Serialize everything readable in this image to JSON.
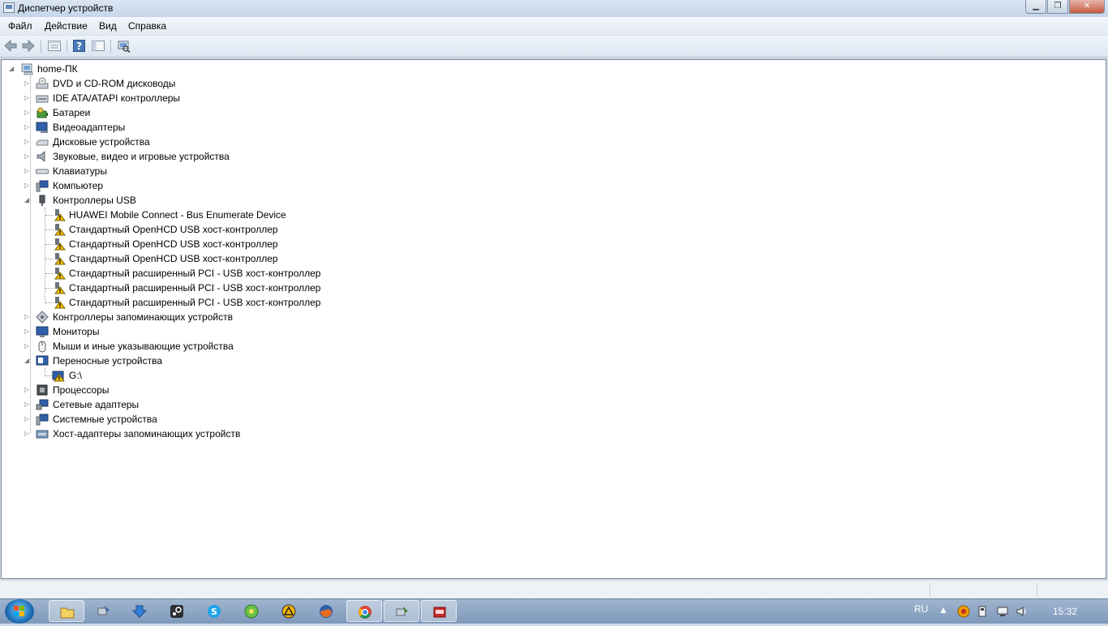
{
  "window": {
    "title": "Диспетчер устройств"
  },
  "menu": {
    "items": [
      "Файл",
      "Действие",
      "Вид",
      "Справка"
    ]
  },
  "toolbar": {
    "buttons": [
      "back-icon",
      "forward-icon",
      "properties-icon",
      "help-icon",
      "show-hide-icon",
      "scan-hardware-icon"
    ]
  },
  "tree": {
    "root": "home-ПК",
    "items": [
      {
        "label": "DVD и CD-ROM дисководы"
      },
      {
        "label": "IDE ATA/ATAPI контроллеры"
      },
      {
        "label": "Батареи"
      },
      {
        "label": "Видеоадаптеры"
      },
      {
        "label": "Дисковые устройства"
      },
      {
        "label": "Звуковые, видео и игровые устройства"
      },
      {
        "label": "Клавиатуры"
      },
      {
        "label": "Компьютер"
      },
      {
        "label": "Контроллеры USB"
      },
      {
        "label": "HUAWEI Mobile Connect - Bus Enumerate Device"
      },
      {
        "label": "Стандартный OpenHCD USB хост-контроллер"
      },
      {
        "label": "Стандартный OpenHCD USB хост-контроллер"
      },
      {
        "label": "Стандартный OpenHCD USB хост-контроллер"
      },
      {
        "label": "Стандартный расширенный PCI - USB хост-контроллер"
      },
      {
        "label": "Стандартный расширенный PCI - USB хост-контроллер"
      },
      {
        "label": "Стандартный расширенный PCI - USB хост-контроллер"
      },
      {
        "label": "Контроллеры запоминающих устройств"
      },
      {
        "label": "Мониторы"
      },
      {
        "label": "Мыши и иные указывающие устройства"
      },
      {
        "label": "Переносные устройства"
      },
      {
        "label": "G:\\"
      },
      {
        "label": "Процессоры"
      },
      {
        "label": "Сетевые адаптеры"
      },
      {
        "label": "Системные устройства"
      },
      {
        "label": "Хост-адаптеры запоминающих устройств"
      }
    ]
  },
  "taskbar": {
    "language": "RU",
    "clock": "15:32"
  },
  "colors": {
    "warning": "#f2c200",
    "taskbar": "#8ea7c6"
  }
}
